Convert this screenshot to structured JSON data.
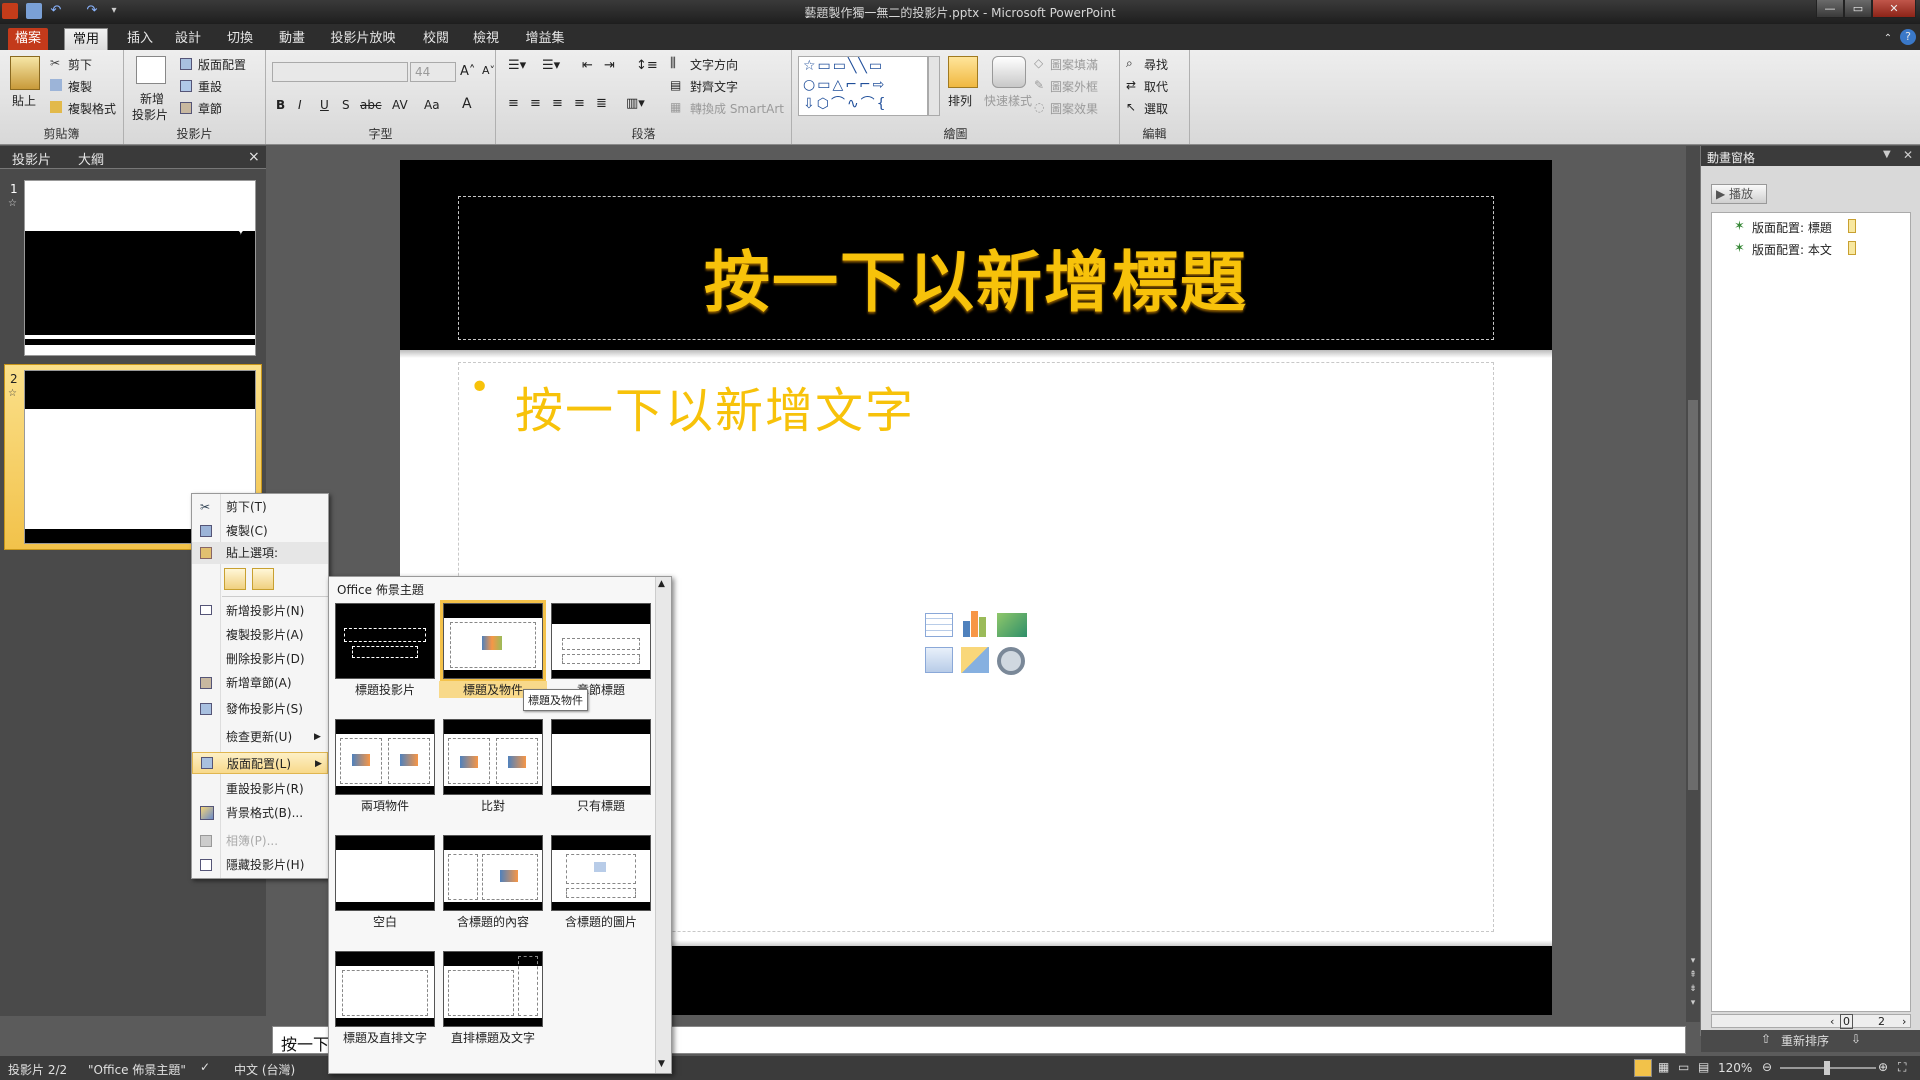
{
  "window": {
    "title": "藝題製作獨一無二的投影片.pptx - Microsoft PowerPoint",
    "min": "—",
    "max": "▭",
    "close": "✕"
  },
  "tabs": [
    "檔案",
    "常用",
    "插入",
    "設計",
    "切換",
    "動畫",
    "投影片放映",
    "校閱",
    "檢視",
    "增益集"
  ],
  "ribbon": {
    "clipboard": {
      "paste": "貼上",
      "cut": "剪下",
      "copy": "複製",
      "format_painter": "複製格式",
      "label": "剪貼簿"
    },
    "slides": {
      "new_slide_1": "新增",
      "new_slide_2": "投影片",
      "layout": "版面配置",
      "reset": "重設",
      "section": "章節",
      "label": "投影片"
    },
    "font": {
      "font_size": "44",
      "label": "字型",
      "bold": "B",
      "italic": "I",
      "underline": "U",
      "shadow": "S",
      "strike": "abc",
      "spacing": "AV",
      "case": "Aa",
      "color": "A"
    },
    "paragraph": {
      "text_direction": "文字方向",
      "align_text": "對齊文字",
      "convert_smartart": "轉換成 SmartArt",
      "label": "段落"
    },
    "drawing": {
      "arrange": "排列",
      "quick_styles": "快速樣式",
      "shape_fill": "圖案填滿",
      "shape_outline": "圖案外框",
      "shape_effects": "圖案效果",
      "label": "繪圖"
    },
    "editing": {
      "find": "尋找",
      "replace": "取代",
      "select": "選取",
      "label": "編輯"
    }
  },
  "left_pane": {
    "tabs": [
      "投影片",
      "大綱"
    ],
    "close": "×",
    "slides": [
      {
        "number": "1"
      },
      {
        "number": "2"
      }
    ]
  },
  "slide": {
    "title_placeholder": "按一下以新增標題",
    "body_placeholder": "按一下以新增文字",
    "bullet": "•",
    "title_color": "#f7c20a"
  },
  "notes": {
    "text": "按一下"
  },
  "context_menu": {
    "items": [
      {
        "label": "剪下(T)",
        "icon": "scissors-icon",
        "disabled": false
      },
      {
        "label": "複製(C)",
        "icon": "copy-icon",
        "disabled": false
      },
      {
        "label": "貼上選項:",
        "icon": "paste-icon",
        "disabled": false
      },
      {
        "label": "新增投影片(N)",
        "icon": "new-slide-icon",
        "disabled": false
      },
      {
        "label": "複製投影片(A)",
        "icon": "",
        "disabled": false
      },
      {
        "label": "刪除投影片(D)",
        "icon": "",
        "disabled": false
      },
      {
        "label": "新增章節(A)",
        "icon": "section-icon",
        "disabled": false
      },
      {
        "label": "發佈投影片(S)",
        "icon": "publish-icon",
        "disabled": false
      },
      {
        "label": "檢查更新(U)",
        "icon": "",
        "disabled": false
      },
      {
        "label": "版面配置(L)",
        "icon": "layout-icon",
        "disabled": false
      },
      {
        "label": "重設投影片(R)",
        "icon": "",
        "disabled": false
      },
      {
        "label": "背景格式(B)...",
        "icon": "background-icon",
        "disabled": false
      },
      {
        "label": "相簿(P)...",
        "icon": "photo-album-icon",
        "disabled": true
      },
      {
        "label": "隱藏投影片(H)",
        "icon": "hide-slide-icon",
        "disabled": false
      }
    ]
  },
  "layout_gallery": {
    "header": "Office 佈景主題",
    "tooltip": "標題及物件",
    "layouts": [
      "標題投影片",
      "標題及物件",
      "章節標題",
      "兩項物件",
      "比對",
      "只有標題",
      "空白",
      "含標題的內容",
      "含標題的圖片",
      "標題及直排文字",
      "直排標題及文字"
    ]
  },
  "animation_pane": {
    "title": "動畫窗格",
    "play": "播放",
    "items": [
      "版面配置: 標題",
      "版面配置: 本文"
    ],
    "timeline_start": "0",
    "timeline_end": "2",
    "reorder": "重新排序"
  },
  "status": {
    "slide": "投影片 2/2",
    "theme": "\"Office 佈景主題\"",
    "language": "中文 (台灣)",
    "zoom": "120%"
  }
}
